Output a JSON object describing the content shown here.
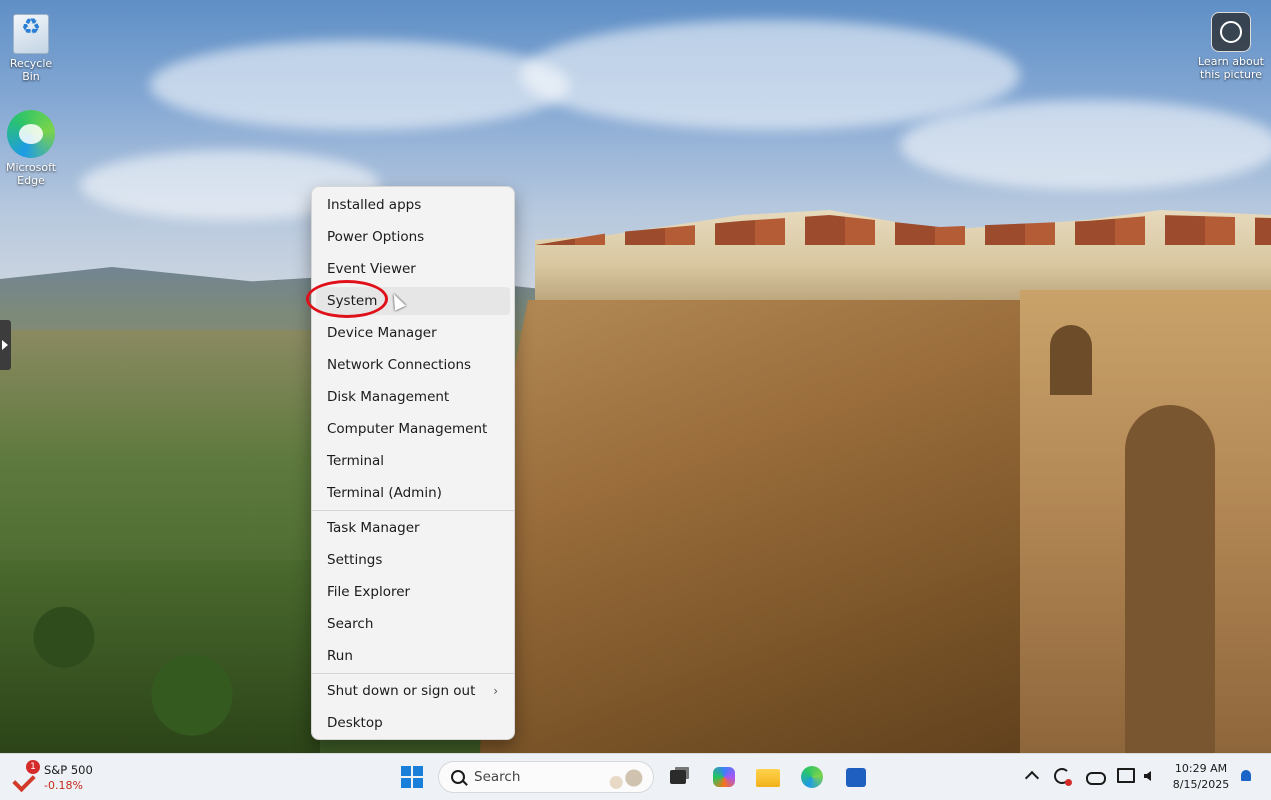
{
  "desktop": {
    "icons": [
      {
        "label": "Recycle Bin",
        "icon": "recycle-bin-icon"
      },
      {
        "label": "Microsoft Edge",
        "icon": "edge-icon"
      },
      {
        "label": "Learn about this picture",
        "icon": "learn-about-picture-icon"
      }
    ]
  },
  "context_menu": {
    "groups": [
      [
        "Installed apps",
        "Power Options",
        "Event Viewer",
        "System",
        "Device Manager",
        "Network Connections",
        "Disk Management",
        "Computer Management",
        "Terminal",
        "Terminal (Admin)"
      ],
      [
        "Task Manager",
        "Settings",
        "File Explorer",
        "Search",
        "Run"
      ],
      [
        "Shut down or sign out",
        "Desktop"
      ]
    ],
    "highlighted": "System",
    "submenu_indicator": "›"
  },
  "taskbar": {
    "widget": {
      "name": "S&P 500",
      "change": "-0.18%",
      "badge": "1",
      "change_color": "#c42b1c"
    },
    "search_placeholder": "Search",
    "pinned": [
      "start-button",
      "task-view-button",
      "copilot-button",
      "file-explorer-button",
      "edge-button",
      "microsoft-store-button"
    ],
    "tray": {
      "time": "10:29 AM",
      "date": "8/15/2025"
    }
  },
  "colors": {
    "accent": "#1a7fd9",
    "highlight_circle": "#e0101a"
  }
}
